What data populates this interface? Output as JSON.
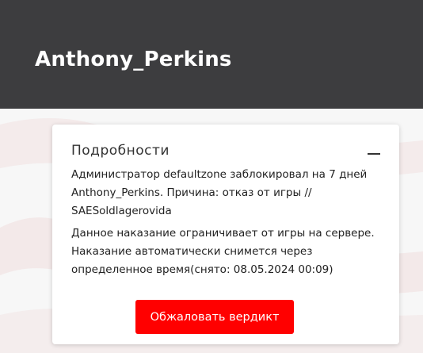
{
  "header": {
    "title": "Anthony_Perkins"
  },
  "card": {
    "title": "Подробности",
    "collapse_icon": "minus-icon",
    "ban_text": "Администратор defaultzone заблокировал на 7 дней Anthony_Perkins. Причина: отказ от игры // SAESoldlagerovida",
    "info_text": "Данное наказание ограничивает от игры на сервере. Наказание автоматически снимется через определенное время(снято: 08.05.2024 00:09)",
    "appeal_button": "Обжаловать вердикт"
  },
  "colors": {
    "header_bg": "#3d3d3f",
    "accent": "#ff0000"
  }
}
